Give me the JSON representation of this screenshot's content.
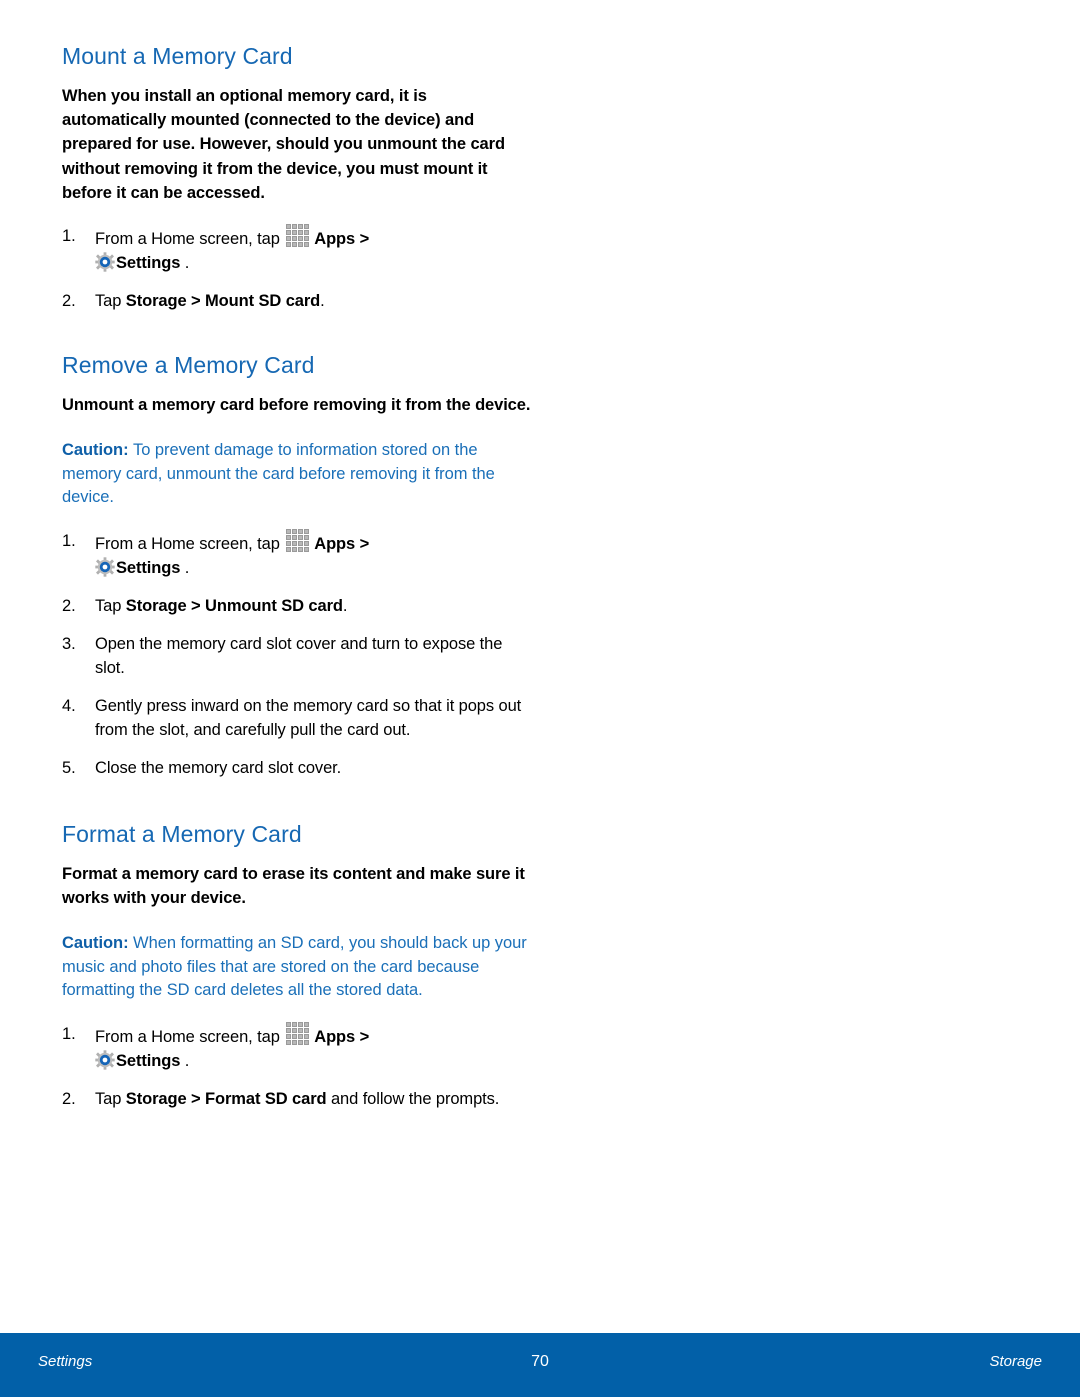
{
  "document": {
    "sections": [
      {
        "id": "mount",
        "heading": "Mount a Memory Card",
        "intro": "When you install an optional memory card, it is automatically mounted (connected to the device) and prepared for use. However, should you unmount the card without removing it from the device, you must mount it before it can be accessed.",
        "steps": [
          {
            "number": "1.",
            "pre": "From a Home screen, tap",
            "apps_label": "Apps",
            "chevron": ">",
            "settings_label": "Settings",
            "post": "."
          },
          {
            "number": "2.",
            "lead": "Tap ",
            "bold_path": "Storage > Mount SD card",
            "tail": "."
          }
        ]
      },
      {
        "id": "remove",
        "heading": "Remove a Memory Card",
        "intro": "Unmount a memory card before removing it from the device.",
        "caution": {
          "label": "Caution",
          "separator": ": ",
          "text": "To prevent damage to information stored on the memory card, unmount the card before removing it from the device."
        },
        "steps": [
          {
            "number": "1.",
            "pre": "From a Home screen, tap",
            "apps_label": "Apps",
            "chevron": ">",
            "settings_label": "Settings",
            "post": "."
          },
          {
            "number": "2.",
            "lead": "Tap ",
            "bold_path": "Storage > Unmount SD card",
            "tail": "."
          },
          {
            "number": "3.",
            "text": "Open the memory card slot cover and turn to expose the slot."
          },
          {
            "number": "4.",
            "text": "Gently press inward on the memory card so that it pops out from the slot, and carefully pull the card out."
          },
          {
            "number": "5.",
            "text": "Close the memory card slot cover."
          }
        ]
      },
      {
        "id": "format",
        "heading": "Format a Memory Card",
        "intro": "Format a memory card to erase its content and make sure it works with your device.",
        "caution": {
          "label": "Caution",
          "separator": ": ",
          "text": "When formatting an SD card, you should back up your music and photo files that are stored on the card because formatting the SD card deletes all the stored data."
        },
        "steps": [
          {
            "number": "1.",
            "pre": "From a Home screen, tap",
            "apps_label": "Apps",
            "chevron": ">",
            "settings_label": "Settings",
            "post": "."
          },
          {
            "number": "2.",
            "lead": "Tap ",
            "bold_path": "Storage > Format SD card",
            "tail": " and follow the prompts."
          }
        ]
      }
    ]
  },
  "footer": {
    "left": "Settings",
    "page_number": "70",
    "right": "Storage"
  },
  "colors": {
    "heading_blue": "#1668B3",
    "caution_blue": "#1A6FB8",
    "caution_label_blue": "#0E5FA8",
    "footer_blue": "#0260A8",
    "body_black": "#000000"
  },
  "icons": {
    "apps": "apps-grid-icon",
    "settings": "gear-icon"
  }
}
